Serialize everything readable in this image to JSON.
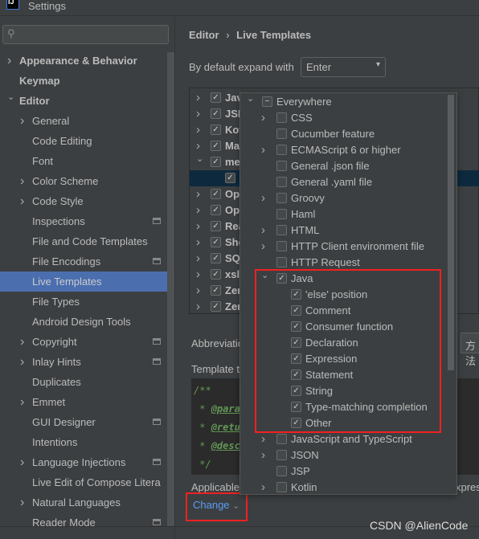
{
  "window": {
    "title": "Settings",
    "logo": "IJ"
  },
  "sidebar": {
    "search_placeholder": "",
    "items": [
      {
        "label": "Appearance & Behavior",
        "level": 0,
        "arrow": "right",
        "bold": true
      },
      {
        "label": "Keymap",
        "level": 0,
        "bold": true
      },
      {
        "label": "Editor",
        "level": 0,
        "arrow": "down",
        "bold": true
      },
      {
        "label": "General",
        "level": 1,
        "arrow": "right"
      },
      {
        "label": "Code Editing",
        "level": 1
      },
      {
        "label": "Font",
        "level": 1
      },
      {
        "label": "Color Scheme",
        "level": 1,
        "arrow": "right"
      },
      {
        "label": "Code Style",
        "level": 1,
        "arrow": "right"
      },
      {
        "label": "Inspections",
        "level": 1,
        "icon": true
      },
      {
        "label": "File and Code Templates",
        "level": 1
      },
      {
        "label": "File Encodings",
        "level": 1,
        "icon": true
      },
      {
        "label": "Live Templates",
        "level": 1,
        "selected": true
      },
      {
        "label": "File Types",
        "level": 1
      },
      {
        "label": "Android Design Tools",
        "level": 1
      },
      {
        "label": "Copyright",
        "level": 1,
        "arrow": "right",
        "icon": true
      },
      {
        "label": "Inlay Hints",
        "level": 1,
        "arrow": "right",
        "icon": true
      },
      {
        "label": "Duplicates",
        "level": 1
      },
      {
        "label": "Emmet",
        "level": 1,
        "arrow": "right"
      },
      {
        "label": "GUI Designer",
        "level": 1,
        "icon": true
      },
      {
        "label": "Intentions",
        "level": 1
      },
      {
        "label": "Language Injections",
        "level": 1,
        "arrow": "right",
        "icon": true
      },
      {
        "label": "Live Edit of Compose Litera",
        "level": 1
      },
      {
        "label": "Natural Languages",
        "level": 1,
        "arrow": "right"
      },
      {
        "label": "Reader Mode",
        "level": 1,
        "icon": true
      }
    ]
  },
  "breadcrumb": {
    "parent": "Editor",
    "separator": "›",
    "current": "Live Templates"
  },
  "expand": {
    "label": "By default expand with",
    "value": "Enter"
  },
  "template_groups": [
    {
      "label": "Jav",
      "arrow": "right"
    },
    {
      "label": "JSP",
      "arrow": "right"
    },
    {
      "label": "Kot",
      "arrow": "right"
    },
    {
      "label": "Mav",
      "arrow": "right"
    },
    {
      "label": "met",
      "arrow": "down"
    },
    {
      "label": "A",
      "child": true,
      "selected": true
    },
    {
      "label": "Ope",
      "arrow": "right"
    },
    {
      "label": "Ope",
      "arrow": "right"
    },
    {
      "label": "Rea",
      "arrow": "right"
    },
    {
      "label": "She",
      "arrow": "right"
    },
    {
      "label": "SQL",
      "arrow": "right"
    },
    {
      "label": "xsl",
      "arrow": "right"
    },
    {
      "label": "Zer",
      "arrow": "right"
    },
    {
      "label": "Zer",
      "arrow": "right"
    }
  ],
  "abbreviation": {
    "label": "Abbreviatio",
    "value": "方法"
  },
  "template_text": {
    "label": "Template t",
    "lines": [
      [
        "/**",
        ""
      ],
      [
        " * ",
        "@para"
      ],
      [
        " * ",
        "@retu"
      ],
      [
        " * ",
        "@desc"
      ],
      [
        " */",
        ""
      ]
    ]
  },
  "applicable": {
    "label": "Applicable",
    "tail": "xpres"
  },
  "change": {
    "label": "Change",
    "chevron": "⌄"
  },
  "popup": {
    "items": [
      {
        "label": "Everywhere",
        "level": 0,
        "arrow": "down",
        "state": "partial"
      },
      {
        "label": "CSS",
        "level": 1,
        "arrow": "right",
        "state": "off"
      },
      {
        "label": "Cucumber feature",
        "level": 1,
        "state": "off"
      },
      {
        "label": "ECMAScript 6 or higher",
        "level": 1,
        "arrow": "right",
        "state": "off"
      },
      {
        "label": "General .json file",
        "level": 1,
        "state": "off"
      },
      {
        "label": "General .yaml file",
        "level": 1,
        "state": "off"
      },
      {
        "label": "Groovy",
        "level": 1,
        "arrow": "right",
        "state": "off"
      },
      {
        "label": "Haml",
        "level": 1,
        "state": "off"
      },
      {
        "label": "HTML",
        "level": 1,
        "arrow": "right",
        "state": "off"
      },
      {
        "label": "HTTP Client environment file",
        "level": 1,
        "arrow": "right",
        "state": "off"
      },
      {
        "label": "HTTP Request",
        "level": 1,
        "state": "off"
      },
      {
        "label": "Java",
        "level": 1,
        "arrow": "down",
        "state": "on"
      },
      {
        "label": "'else' position",
        "level": 2,
        "state": "on"
      },
      {
        "label": "Comment",
        "level": 2,
        "state": "on"
      },
      {
        "label": "Consumer function",
        "level": 2,
        "state": "on"
      },
      {
        "label": "Declaration",
        "level": 2,
        "state": "on"
      },
      {
        "label": "Expression",
        "level": 2,
        "state": "on"
      },
      {
        "label": "Statement",
        "level": 2,
        "state": "on"
      },
      {
        "label": "String",
        "level": 2,
        "state": "on"
      },
      {
        "label": "Type-matching completion",
        "level": 2,
        "state": "on"
      },
      {
        "label": "Other",
        "level": 2,
        "state": "on"
      },
      {
        "label": "JavaScript and TypeScript",
        "level": 1,
        "arrow": "right",
        "state": "off"
      },
      {
        "label": "JSON",
        "level": 1,
        "arrow": "right",
        "state": "off"
      },
      {
        "label": "JSP",
        "level": 1,
        "state": "off"
      },
      {
        "label": "Kotlin",
        "level": 1,
        "arrow": "right",
        "state": "off"
      }
    ]
  },
  "colors": {
    "highlight": "#f02020",
    "selection": "#4b6eaf",
    "link": "#589df6"
  },
  "watermark": "CSDN @AlienCode"
}
